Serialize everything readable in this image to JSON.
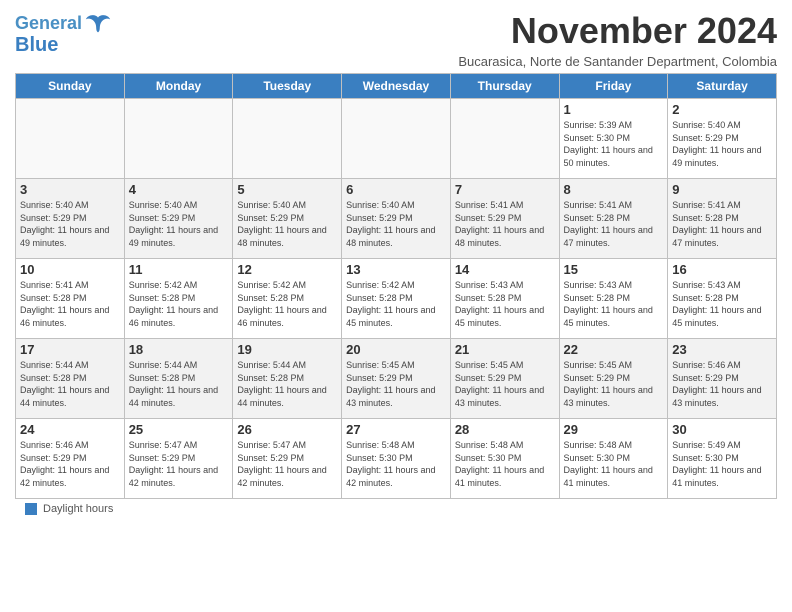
{
  "header": {
    "logo_line1": "General",
    "logo_line2": "Blue",
    "month_title": "November 2024",
    "location": "Bucarasica, Norte de Santander Department, Colombia"
  },
  "days_of_week": [
    "Sunday",
    "Monday",
    "Tuesday",
    "Wednesday",
    "Thursday",
    "Friday",
    "Saturday"
  ],
  "weeks": [
    [
      {
        "day": "",
        "info": ""
      },
      {
        "day": "",
        "info": ""
      },
      {
        "day": "",
        "info": ""
      },
      {
        "day": "",
        "info": ""
      },
      {
        "day": "",
        "info": ""
      },
      {
        "day": "1",
        "info": "Sunrise: 5:39 AM\nSunset: 5:30 PM\nDaylight: 11 hours and 50 minutes."
      },
      {
        "day": "2",
        "info": "Sunrise: 5:40 AM\nSunset: 5:29 PM\nDaylight: 11 hours and 49 minutes."
      }
    ],
    [
      {
        "day": "3",
        "info": "Sunrise: 5:40 AM\nSunset: 5:29 PM\nDaylight: 11 hours and 49 minutes."
      },
      {
        "day": "4",
        "info": "Sunrise: 5:40 AM\nSunset: 5:29 PM\nDaylight: 11 hours and 49 minutes."
      },
      {
        "day": "5",
        "info": "Sunrise: 5:40 AM\nSunset: 5:29 PM\nDaylight: 11 hours and 48 minutes."
      },
      {
        "day": "6",
        "info": "Sunrise: 5:40 AM\nSunset: 5:29 PM\nDaylight: 11 hours and 48 minutes."
      },
      {
        "day": "7",
        "info": "Sunrise: 5:41 AM\nSunset: 5:29 PM\nDaylight: 11 hours and 48 minutes."
      },
      {
        "day": "8",
        "info": "Sunrise: 5:41 AM\nSunset: 5:28 PM\nDaylight: 11 hours and 47 minutes."
      },
      {
        "day": "9",
        "info": "Sunrise: 5:41 AM\nSunset: 5:28 PM\nDaylight: 11 hours and 47 minutes."
      }
    ],
    [
      {
        "day": "10",
        "info": "Sunrise: 5:41 AM\nSunset: 5:28 PM\nDaylight: 11 hours and 46 minutes."
      },
      {
        "day": "11",
        "info": "Sunrise: 5:42 AM\nSunset: 5:28 PM\nDaylight: 11 hours and 46 minutes."
      },
      {
        "day": "12",
        "info": "Sunrise: 5:42 AM\nSunset: 5:28 PM\nDaylight: 11 hours and 46 minutes."
      },
      {
        "day": "13",
        "info": "Sunrise: 5:42 AM\nSunset: 5:28 PM\nDaylight: 11 hours and 45 minutes."
      },
      {
        "day": "14",
        "info": "Sunrise: 5:43 AM\nSunset: 5:28 PM\nDaylight: 11 hours and 45 minutes."
      },
      {
        "day": "15",
        "info": "Sunrise: 5:43 AM\nSunset: 5:28 PM\nDaylight: 11 hours and 45 minutes."
      },
      {
        "day": "16",
        "info": "Sunrise: 5:43 AM\nSunset: 5:28 PM\nDaylight: 11 hours and 45 minutes."
      }
    ],
    [
      {
        "day": "17",
        "info": "Sunrise: 5:44 AM\nSunset: 5:28 PM\nDaylight: 11 hours and 44 minutes."
      },
      {
        "day": "18",
        "info": "Sunrise: 5:44 AM\nSunset: 5:28 PM\nDaylight: 11 hours and 44 minutes."
      },
      {
        "day": "19",
        "info": "Sunrise: 5:44 AM\nSunset: 5:28 PM\nDaylight: 11 hours and 44 minutes."
      },
      {
        "day": "20",
        "info": "Sunrise: 5:45 AM\nSunset: 5:29 PM\nDaylight: 11 hours and 43 minutes."
      },
      {
        "day": "21",
        "info": "Sunrise: 5:45 AM\nSunset: 5:29 PM\nDaylight: 11 hours and 43 minutes."
      },
      {
        "day": "22",
        "info": "Sunrise: 5:45 AM\nSunset: 5:29 PM\nDaylight: 11 hours and 43 minutes."
      },
      {
        "day": "23",
        "info": "Sunrise: 5:46 AM\nSunset: 5:29 PM\nDaylight: 11 hours and 43 minutes."
      }
    ],
    [
      {
        "day": "24",
        "info": "Sunrise: 5:46 AM\nSunset: 5:29 PM\nDaylight: 11 hours and 42 minutes."
      },
      {
        "day": "25",
        "info": "Sunrise: 5:47 AM\nSunset: 5:29 PM\nDaylight: 11 hours and 42 minutes."
      },
      {
        "day": "26",
        "info": "Sunrise: 5:47 AM\nSunset: 5:29 PM\nDaylight: 11 hours and 42 minutes."
      },
      {
        "day": "27",
        "info": "Sunrise: 5:48 AM\nSunset: 5:30 PM\nDaylight: 11 hours and 42 minutes."
      },
      {
        "day": "28",
        "info": "Sunrise: 5:48 AM\nSunset: 5:30 PM\nDaylight: 11 hours and 41 minutes."
      },
      {
        "day": "29",
        "info": "Sunrise: 5:48 AM\nSunset: 5:30 PM\nDaylight: 11 hours and 41 minutes."
      },
      {
        "day": "30",
        "info": "Sunrise: 5:49 AM\nSunset: 5:30 PM\nDaylight: 11 hours and 41 minutes."
      }
    ]
  ],
  "footer": {
    "legend_label": "Daylight hours"
  }
}
